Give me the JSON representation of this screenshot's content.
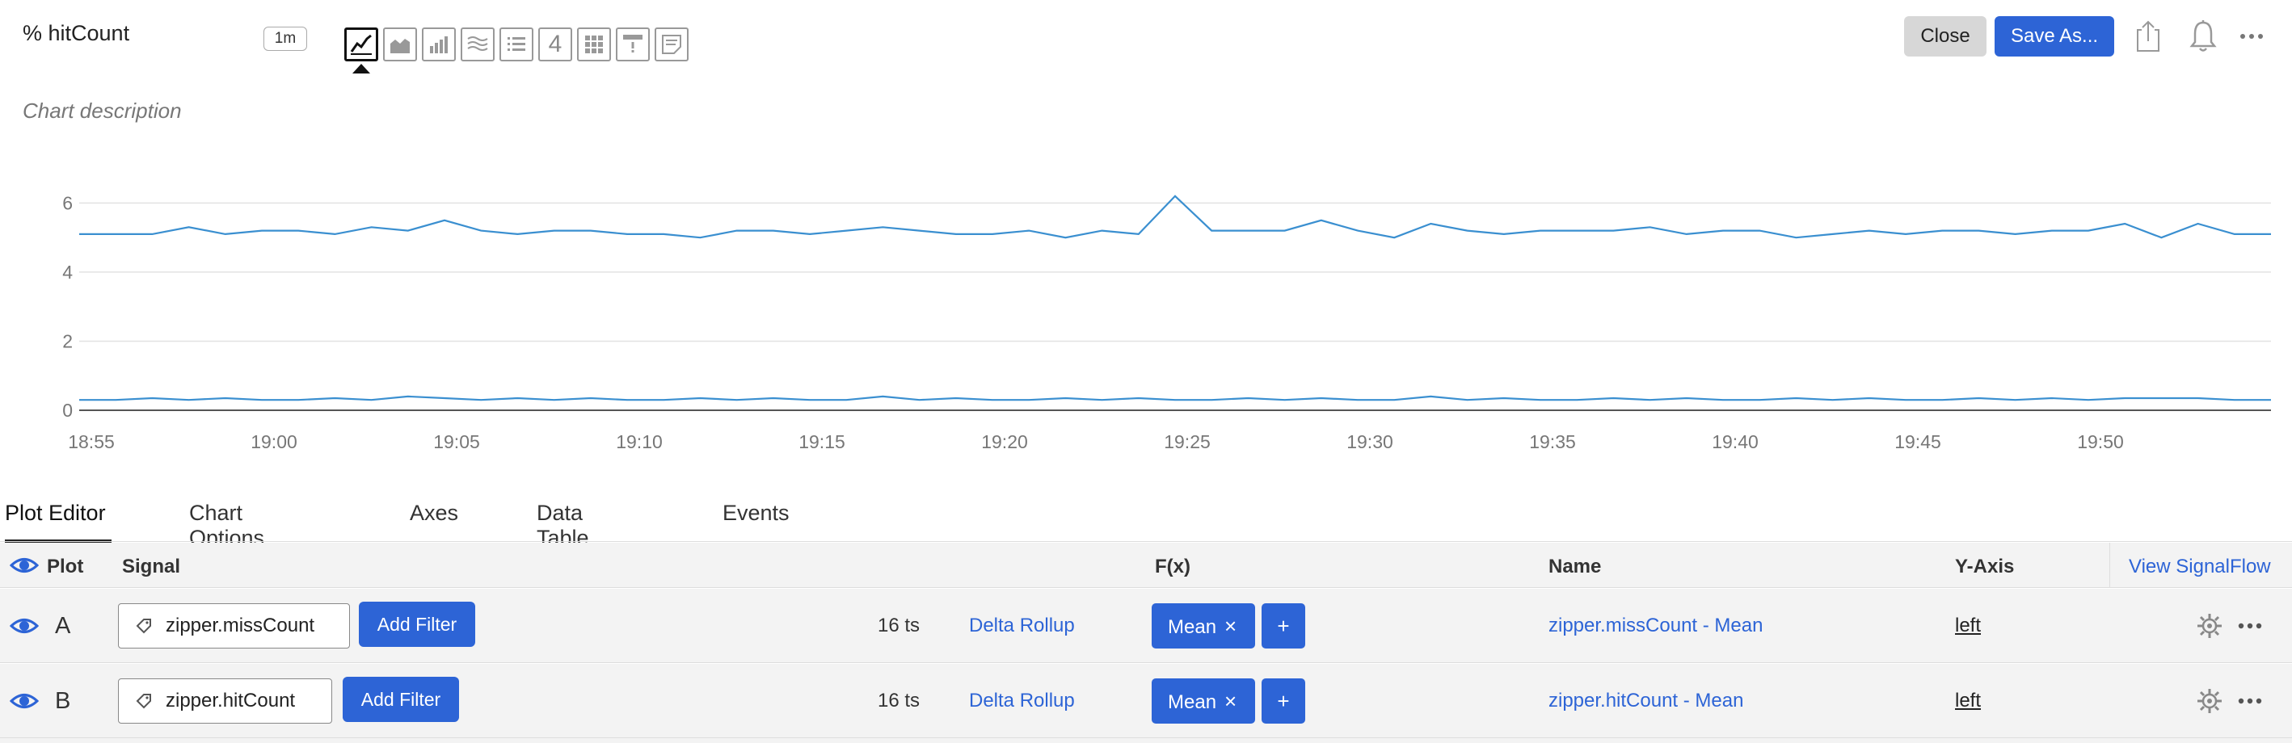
{
  "header": {
    "title": "% hitCount",
    "resolution": "1m",
    "close_label": "Close",
    "save_as_label": "Save As...",
    "chart_types": [
      {
        "name": "line-chart-icon",
        "active": true
      },
      {
        "name": "area-chart-icon",
        "active": false
      },
      {
        "name": "column-chart-icon",
        "active": false
      },
      {
        "name": "histogram-chart-icon",
        "active": false
      },
      {
        "name": "list-chart-icon",
        "active": false
      },
      {
        "name": "single-value-icon",
        "label": "4",
        "active": false
      },
      {
        "name": "heatmap-chart-icon",
        "active": false
      },
      {
        "name": "event-feed-icon",
        "active": false
      },
      {
        "name": "text-note-icon",
        "active": false
      }
    ],
    "icons": [
      "share-icon",
      "bell-icon",
      "more-icon"
    ]
  },
  "description": "Chart description",
  "chart_data": {
    "type": "line",
    "x": [
      "18:55",
      "18:56",
      "18:57",
      "18:58",
      "18:59",
      "19:00",
      "19:01",
      "19:02",
      "19:03",
      "19:04",
      "19:05",
      "19:06",
      "19:07",
      "19:08",
      "19:09",
      "19:10",
      "19:11",
      "19:12",
      "19:13",
      "19:14",
      "19:15",
      "19:16",
      "19:17",
      "19:18",
      "19:19",
      "19:20",
      "19:21",
      "19:22",
      "19:23",
      "19:24",
      "19:25",
      "19:26",
      "19:27",
      "19:28",
      "19:29",
      "19:30",
      "19:31",
      "19:32",
      "19:33",
      "19:34",
      "19:35",
      "19:36",
      "19:37",
      "19:38",
      "19:39",
      "19:40",
      "19:41",
      "19:42",
      "19:43",
      "19:44",
      "19:45",
      "19:46",
      "19:47",
      "19:48",
      "19:49",
      "19:50",
      "19:51",
      "19:52",
      "19:53",
      "19:54",
      "19:55"
    ],
    "x_ticks": [
      "18:55",
      "19:00",
      "19:05",
      "19:10",
      "19:15",
      "19:20",
      "19:25",
      "19:30",
      "19:35",
      "19:40",
      "19:45",
      "19:50"
    ],
    "y_ticks": [
      0,
      2,
      4,
      6
    ],
    "ylim": [
      0,
      6.5
    ],
    "grid": true,
    "series": [
      {
        "color": "#3a8fd0",
        "values": [
          5.1,
          5.1,
          5.1,
          5.3,
          5.1,
          5.2,
          5.2,
          5.1,
          5.3,
          5.2,
          5.5,
          5.2,
          5.1,
          5.2,
          5.2,
          5.1,
          5.1,
          5.0,
          5.2,
          5.2,
          5.1,
          5.2,
          5.3,
          5.2,
          5.1,
          5.1,
          5.2,
          5.0,
          5.2,
          5.1,
          6.2,
          5.2,
          5.2,
          5.2,
          5.5,
          5.2,
          5.0,
          5.4,
          5.2,
          5.1,
          5.2,
          5.2,
          5.2,
          5.3,
          5.1,
          5.2,
          5.2,
          5.0,
          5.1,
          5.2,
          5.1,
          5.2,
          5.2,
          5.1,
          5.2,
          5.2,
          5.4,
          5.0,
          5.4,
          5.1,
          5.1
        ]
      },
      {
        "color": "#3a8fd0",
        "values": [
          0.3,
          0.3,
          0.35,
          0.3,
          0.35,
          0.3,
          0.3,
          0.35,
          0.3,
          0.4,
          0.35,
          0.3,
          0.35,
          0.3,
          0.35,
          0.3,
          0.3,
          0.35,
          0.3,
          0.35,
          0.3,
          0.3,
          0.4,
          0.3,
          0.35,
          0.3,
          0.3,
          0.35,
          0.3,
          0.35,
          0.3,
          0.3,
          0.35,
          0.3,
          0.35,
          0.3,
          0.3,
          0.4,
          0.3,
          0.35,
          0.3,
          0.3,
          0.35,
          0.3,
          0.35,
          0.3,
          0.3,
          0.35,
          0.3,
          0.35,
          0.3,
          0.3,
          0.35,
          0.3,
          0.35,
          0.3,
          0.35,
          0.35,
          0.35,
          0.3,
          0.3
        ]
      }
    ]
  },
  "tabs": [
    "Plot Editor",
    "Chart Options",
    "Axes",
    "Data Table",
    "Events"
  ],
  "table": {
    "headers": {
      "plot": "Plot",
      "signal": "Signal",
      "fx": "F(x)",
      "name": "Name",
      "yaxis": "Y-Axis",
      "view_signalflow": "View SignalFlow"
    },
    "rows": [
      {
        "letter": "A",
        "signal": "zipper.missCount",
        "add_filter": "Add Filter",
        "ts": "16 ts",
        "rollup": "Delta Rollup",
        "fx": "Mean",
        "fx_remove": "×",
        "fx_add": "+",
        "name": "zipper.missCount - Mean",
        "yaxis": "left"
      },
      {
        "letter": "B",
        "signal": "zipper.hitCount",
        "add_filter": "Add Filter",
        "ts": "16 ts",
        "rollup": "Delta Rollup",
        "fx": "Mean",
        "fx_remove": "×",
        "fx_add": "+",
        "name": "zipper.hitCount - Mean",
        "yaxis": "left"
      }
    ]
  }
}
